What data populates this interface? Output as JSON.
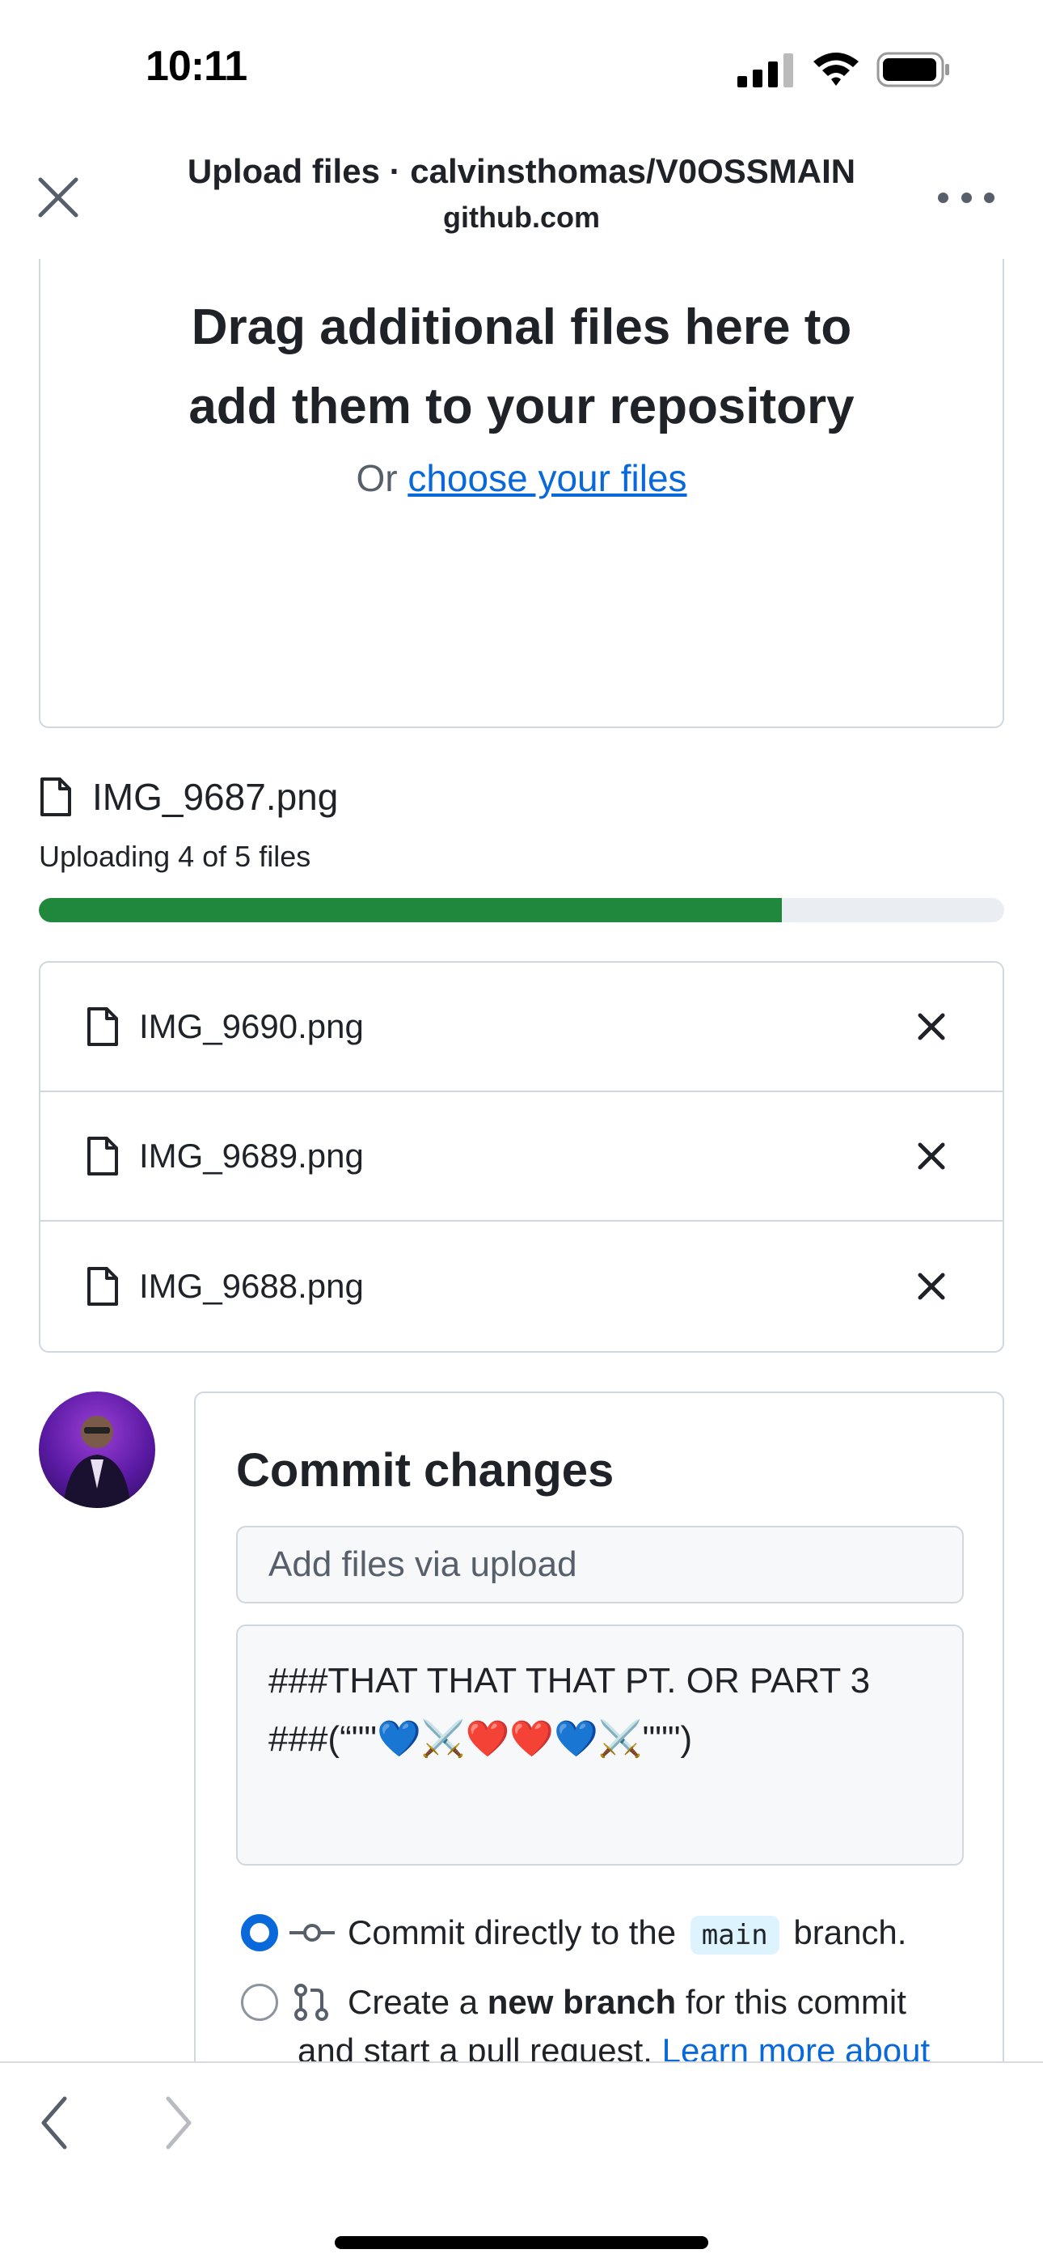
{
  "status_bar": {
    "time": "10:11"
  },
  "header": {
    "title": "Upload files · calvinsthomas/V0OSSMAIN",
    "subtitle": "github.com"
  },
  "dropzone": {
    "heading_line1": "Drag additional files here to",
    "heading_line2": "add them to your repository",
    "or_text": "Or",
    "choose_link": "choose your files"
  },
  "upload": {
    "current_file": "IMG_9687.png",
    "status": "Uploading 4 of 5 files",
    "progress_fraction": 0.77,
    "progress_color": "#1f883d"
  },
  "queued_files": [
    {
      "name": "IMG_9690.png"
    },
    {
      "name": "IMG_9689.png"
    },
    {
      "name": "IMG_9688.png"
    }
  ],
  "commit": {
    "title": "Commit changes",
    "summary_placeholder": "Add files via upload",
    "description_line1": "###THAT THAT THAT PT. OR PART 3",
    "description_line2": "###(“\"\"💙⚔️❤️❤️💙⚔️\"\"\")",
    "option_direct_prefix": "Commit directly to the",
    "option_direct_branch": "main",
    "option_direct_suffix": "branch.",
    "option_new_prefix": "Create a",
    "option_new_bold": "new branch",
    "option_new_suffix": "for this commit",
    "option_new_line2": "and start a pull request.",
    "option_new_link": "Learn more about"
  },
  "colors": {
    "accent": "#0969da",
    "progress": "#1f883d",
    "border": "#d0d7de"
  }
}
